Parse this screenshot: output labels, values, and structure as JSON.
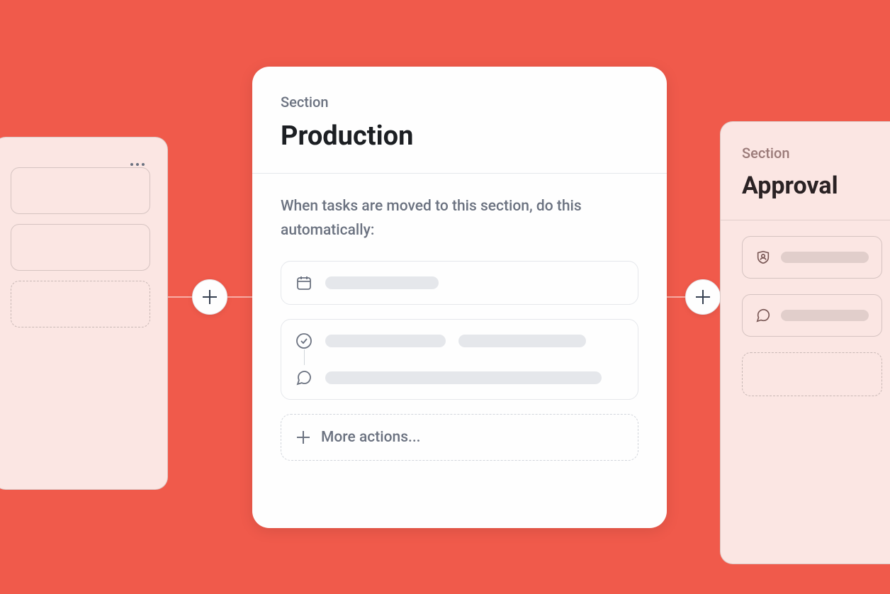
{
  "center": {
    "section_label": "Section",
    "title": "Production",
    "description": "When tasks are moved to this section, do this automatically:",
    "more_actions_label": "More actions..."
  },
  "right": {
    "section_label": "Section",
    "title": "Approval"
  }
}
